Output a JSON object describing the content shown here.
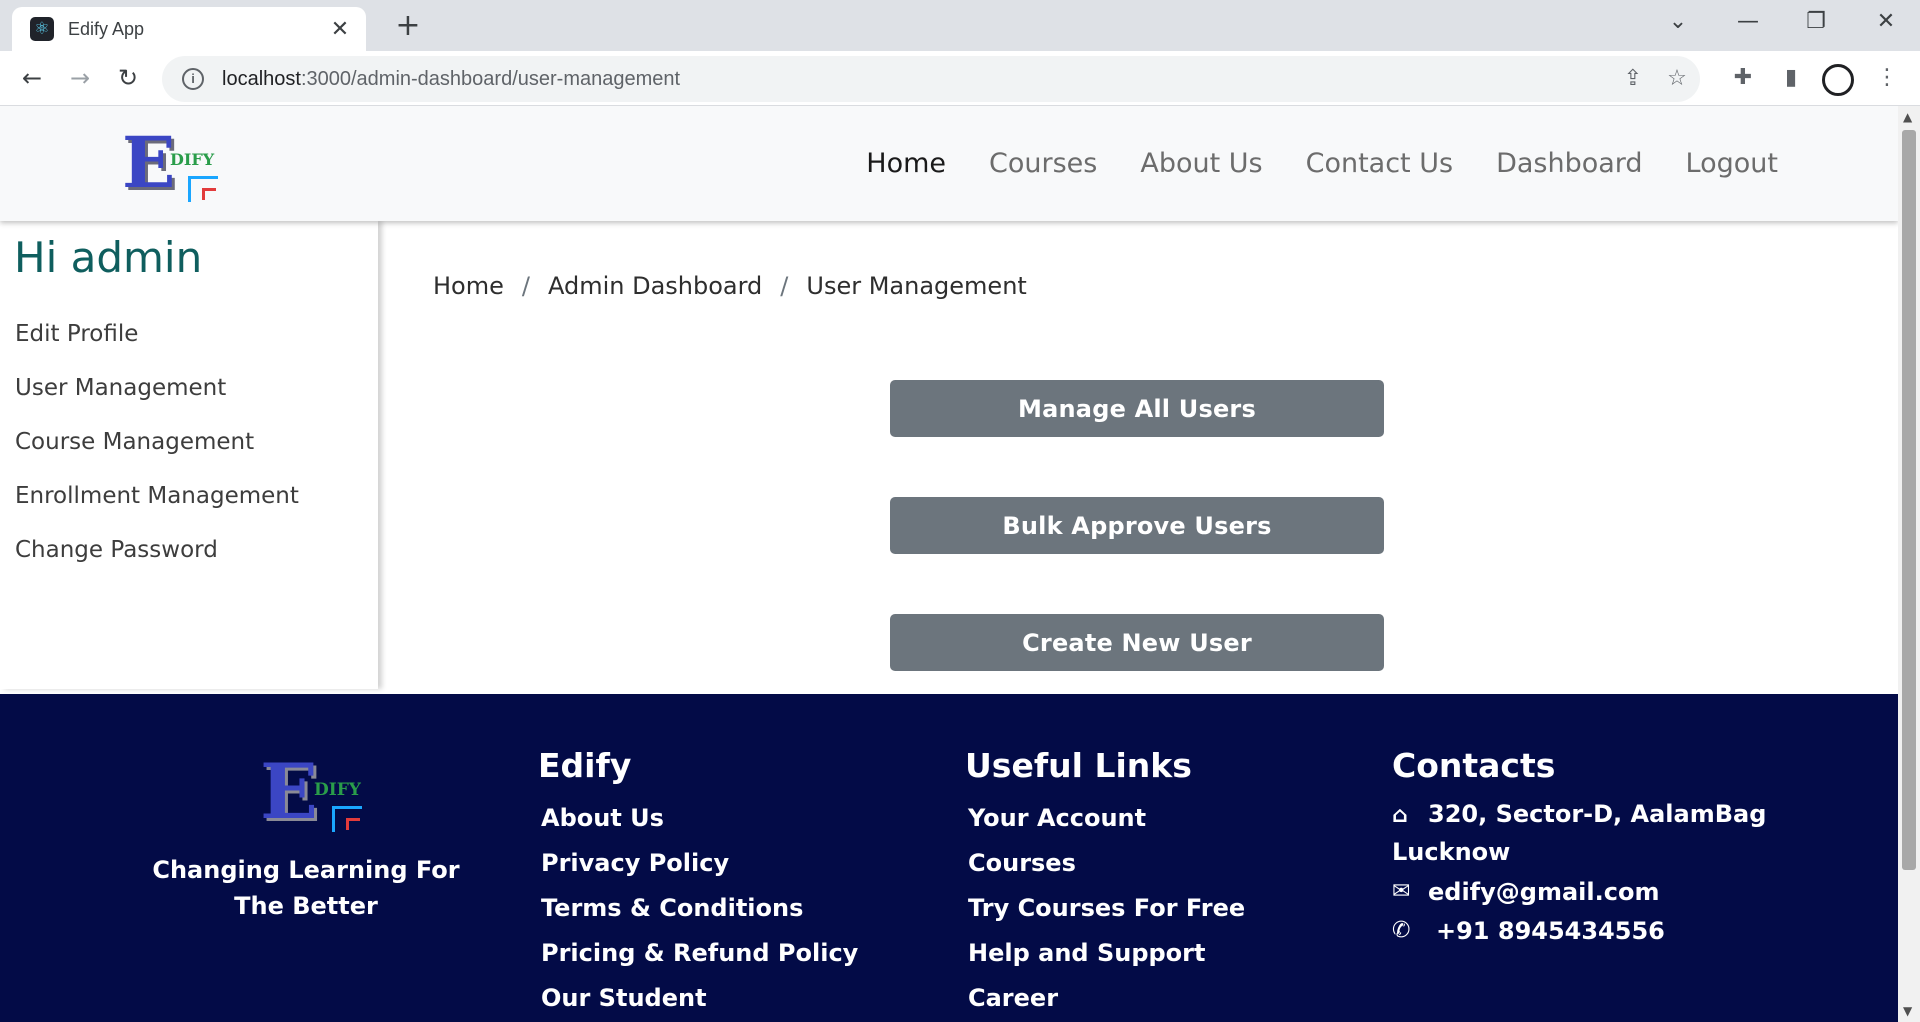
{
  "browser": {
    "tab_title": "Edify App",
    "tab_close": "✕",
    "new_tab": "+",
    "url_host": "localhost",
    "url_path": ":3000/admin-dashboard/user-management",
    "info_icon": "i"
  },
  "header": {
    "logo_letter": "E",
    "logo_text": "DIFY",
    "nav": [
      {
        "label": "Home",
        "active": true
      },
      {
        "label": "Courses"
      },
      {
        "label": "About Us"
      },
      {
        "label": "Contact Us"
      },
      {
        "label": "Dashboard"
      },
      {
        "label": "Logout"
      }
    ]
  },
  "sidebar": {
    "greeting": "Hi admin",
    "items": [
      {
        "label": "Edit Profile"
      },
      {
        "label": "User Management"
      },
      {
        "label": "Course Management"
      },
      {
        "label": "Enrollment Management"
      },
      {
        "label": "Change Password"
      }
    ]
  },
  "breadcrumb": {
    "items": [
      "Home",
      "Admin Dashboard",
      "User Management"
    ],
    "separator": "/"
  },
  "actions": {
    "manage_all": "Manage All Users",
    "bulk_approve": "Bulk Approve Users",
    "create_new": "Create New User",
    "button_color": "#6c757d"
  },
  "footer": {
    "logo_letter": "E",
    "logo_text": "DIFY",
    "tagline": "Changing Learning For The Better",
    "col1": {
      "heading": "Edify",
      "links": [
        "About Us",
        "Privacy Policy",
        "Terms & Conditions",
        "Pricing & Refund Policy",
        "Our Student"
      ]
    },
    "col2": {
      "heading": "Useful Links",
      "links": [
        "Your Account",
        "Courses",
        "Try Courses For Free",
        "Help and Support",
        "Career"
      ]
    },
    "col3": {
      "heading": "Contacts",
      "address": "320, Sector-D, AalamBag Lucknow",
      "email": "edify@gmail.com",
      "phone": "+91 8945434556"
    },
    "background": "#030b47"
  }
}
